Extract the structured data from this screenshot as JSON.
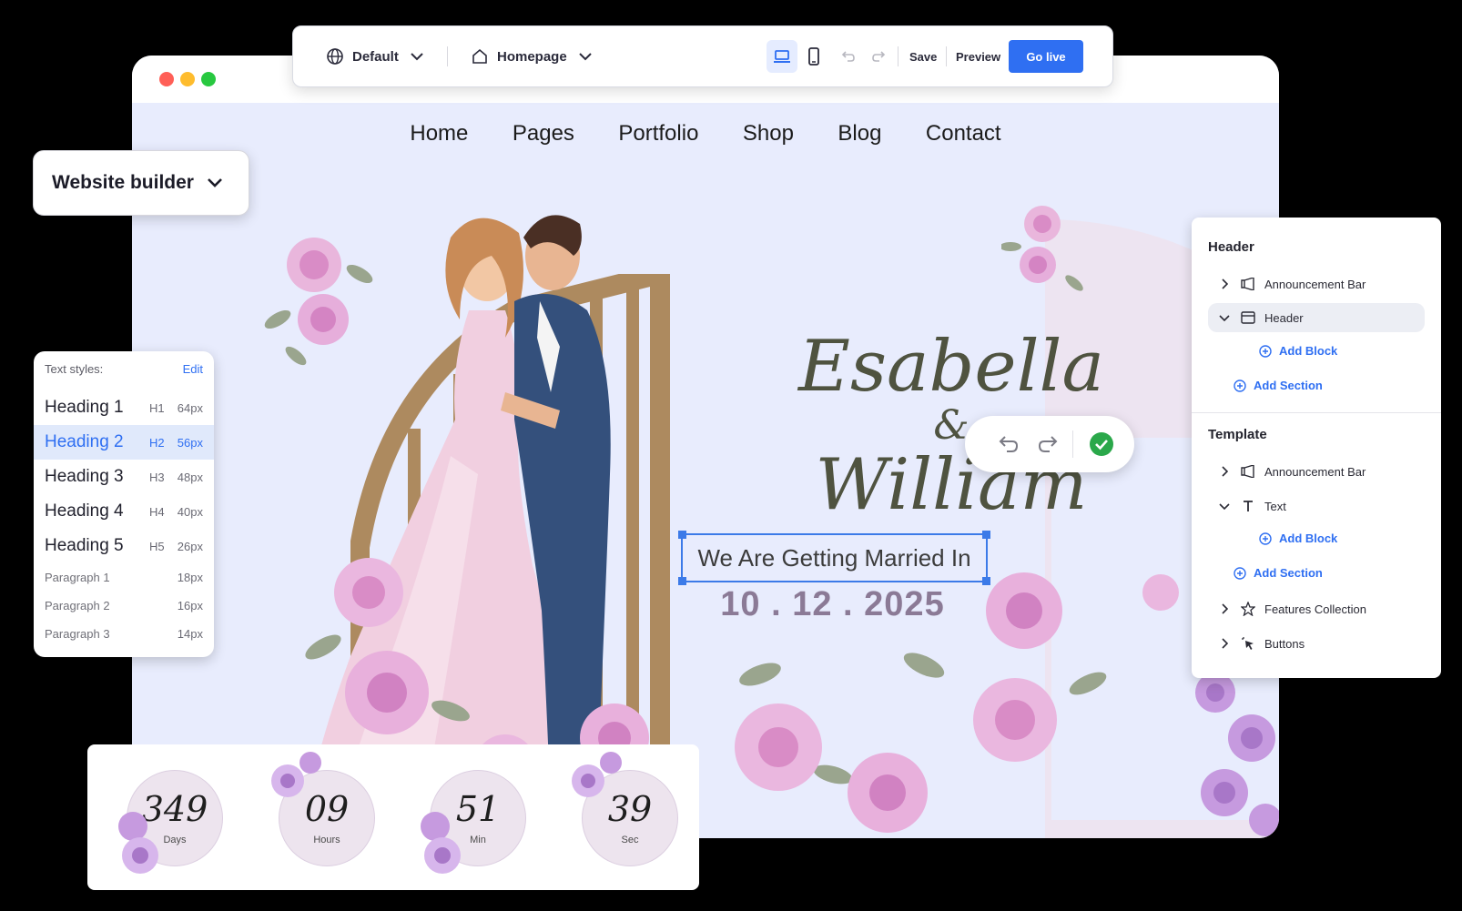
{
  "toolbar": {
    "locale_label": "Default",
    "page_label": "Homepage",
    "save_label": "Save",
    "preview_label": "Preview",
    "go_live_label": "Go live"
  },
  "site": {
    "nav": [
      "Home",
      "Pages",
      "Portfolio",
      "Shop",
      "Blog",
      "Contact"
    ],
    "name_first": "Esabella",
    "ampersand": "&",
    "name_second": "William",
    "tagline": "We Are Getting Married In",
    "date": "10 . 12 . 2025"
  },
  "builder_dropdown": {
    "label": "Website builder"
  },
  "text_styles": {
    "header": "Text styles:",
    "edit_label": "Edit",
    "items": [
      {
        "name": "Heading 1",
        "tag": "H1",
        "size": "64px"
      },
      {
        "name": "Heading 2",
        "tag": "H2",
        "size": "56px"
      },
      {
        "name": "Heading 3",
        "tag": "H3",
        "size": "48px"
      },
      {
        "name": "Heading 4",
        "tag": "H4",
        "size": "40px"
      },
      {
        "name": "Heading 5",
        "tag": "H5",
        "size": "26px"
      },
      {
        "name": "Paragraph 1",
        "tag": "",
        "size": "18px"
      },
      {
        "name": "Paragraph 2",
        "tag": "",
        "size": "16px"
      },
      {
        "name": "Paragraph 3",
        "tag": "",
        "size": "14px"
      }
    ],
    "selected": "Heading 2"
  },
  "layers": {
    "header_title": "Header",
    "header_items": [
      "Announcement Bar",
      "Header"
    ],
    "add_block": "Add Block",
    "add_section": "Add Section",
    "template_title": "Template",
    "template_items": [
      "Announcement Bar",
      "Text",
      "Features Collection",
      "Buttons"
    ]
  },
  "countdown": [
    {
      "value": "349",
      "unit": "Days"
    },
    {
      "value": "09",
      "unit": "Hours"
    },
    {
      "value": "51",
      "unit": "Min"
    },
    {
      "value": "39",
      "unit": "Sec"
    }
  ],
  "colors": {
    "accent": "#2f6ff2",
    "canvas": "#e8ecfd",
    "date": "#8b7a96"
  }
}
